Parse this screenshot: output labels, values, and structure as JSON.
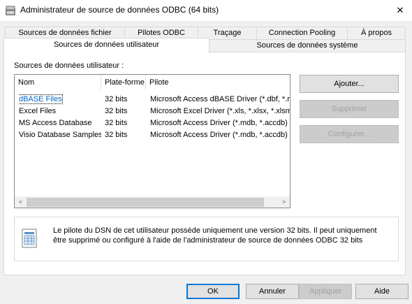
{
  "window": {
    "title": "Administrateur de source de données ODBC (64 bits)",
    "close": "✕"
  },
  "tabs": {
    "row1": [
      "Sources de données fichier",
      "Pilotes ODBC",
      "Traçage",
      "Connection Pooling",
      "À propos"
    ],
    "row2": [
      "Sources de données utilisateur",
      "Sources de données système"
    ],
    "active": "Sources de données utilisateur"
  },
  "list": {
    "caption": "Sources de données utilisateur :",
    "columns": [
      "Nom",
      "Plate-forme",
      "Pilote"
    ],
    "rows": [
      {
        "name": "dBASE Files",
        "platform": "32 bits",
        "driver": "Microsoft Access dBASE Driver (*.dbf, *.nd",
        "selected": true
      },
      {
        "name": "Excel Files",
        "platform": "32 bits",
        "driver": "Microsoft Excel Driver (*.xls, *.xlsx, *.xlsm, *",
        "selected": false
      },
      {
        "name": "MS Access Database",
        "platform": "32 bits",
        "driver": "Microsoft Access Driver (*.mdb, *.accdb)",
        "selected": false
      },
      {
        "name": "Visio Database Samples",
        "platform": "32 bits",
        "driver": "Microsoft Access Driver (*.mdb, *.accdb)",
        "selected": false
      }
    ],
    "scroll_left": "<",
    "scroll_right": ">"
  },
  "side_buttons": {
    "add": "Ajouter...",
    "remove": "Supprimer",
    "configure": "Configurer..."
  },
  "info": {
    "text": "Le pilote du DSN de cet utilisateur possède uniquement une version 32 bits. Il peut uniquement être supprimé ou configuré à l'aide de l'administrateur de source de données ODBC 32 bits"
  },
  "footer": {
    "ok": "OK",
    "cancel": "Annuler",
    "apply": "Appliquer",
    "help": "Aide"
  }
}
